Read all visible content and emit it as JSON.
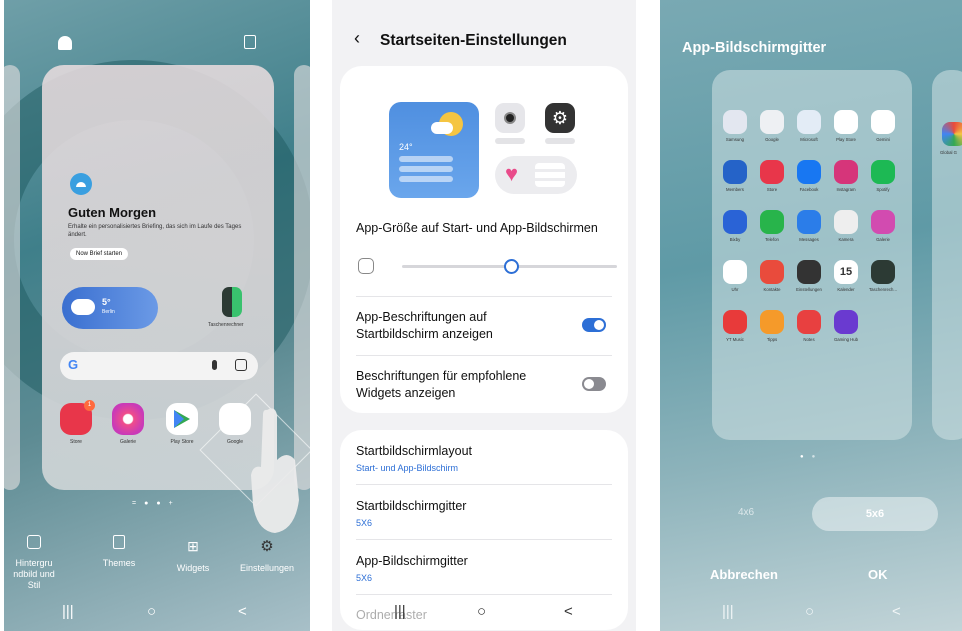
{
  "panel1": {
    "briefing_title": "Guten Morgen",
    "briefing_text": "Erhalte ein personalisiertes Briefing, das sich im Laufe des Tages ändert.",
    "briefing_button": "Now Brief starten",
    "weather_temp": "5°",
    "weather_city": "Berlin",
    "calc_label": "Taschenrechner",
    "apps": [
      "Store",
      "Galerie",
      "Play Store",
      "Google"
    ],
    "store_badge": "1",
    "dock": [
      "Hintergru ndbild und Stil",
      "Themes",
      "Widgets",
      "Einstellungen"
    ],
    "nav": [
      "|||",
      "○",
      "<"
    ]
  },
  "panel2": {
    "title": "Startseiten-Einstellungen",
    "preview_temp": "24°",
    "app_size_label": "App-Größe auf Start- und App-Bildschirmen",
    "toggle1_label": "App-Beschriftungen auf Startbildschirm anzeigen",
    "toggle1_on": true,
    "toggle2_label": "Beschriftungen für empfohlene Widgets anzeigen",
    "toggle2_on": false,
    "rows": [
      {
        "title": "Startbildschirmlayout",
        "sub": "Start- und App-Bildschirm"
      },
      {
        "title": "Startbildschirmgitter",
        "sub": "5X6"
      },
      {
        "title": "App-Bildschirmgitter",
        "sub": "5X6"
      },
      {
        "title": "Ordnerraster",
        "sub": ""
      }
    ],
    "nav": [
      "|||",
      "○",
      "<"
    ]
  },
  "panel3": {
    "title": "App-Bildschirmgitter",
    "apps": [
      "Samsung",
      "Google",
      "Microsoft",
      "Play Store",
      "Gemini",
      "Members",
      "Store",
      "Facebook",
      "Instagram",
      "Spotify",
      "Bixby",
      "Telefon",
      "Messages",
      "Kamera",
      "Galerie",
      "Uhr",
      "Kontakte",
      "Einstellungen",
      "Kalender",
      "Taschenrech...",
      "YT Music",
      "Tipps",
      "Notes",
      "Gaming Hub"
    ],
    "side_label": "Global G",
    "calendar_day": "15",
    "options": [
      "4x6",
      "5x6"
    ],
    "cancel": "Abbrechen",
    "ok": "OK",
    "nav": [
      "|||",
      "○",
      "<"
    ]
  },
  "colors": {
    "accent": "#2d6fd6",
    "toggle_off": "#8a8a90"
  }
}
